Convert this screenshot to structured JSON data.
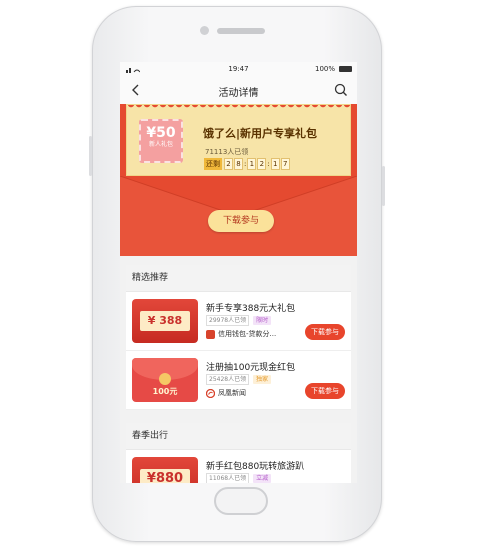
{
  "status_bar": {
    "time": "19:47",
    "battery": "100%"
  },
  "nav": {
    "title": "活动详情",
    "back_icon": "chevron-left-icon",
    "search_icon": "search-icon"
  },
  "banner": {
    "coupon_amount": "¥50",
    "coupon_label": "新人礼包",
    "title": "饿了么|新用户专享礼包",
    "claimed": "71113人已领",
    "countdown_label": "还剩",
    "countdown_digits": [
      "2",
      "8",
      "1",
      "2",
      "1",
      "7"
    ],
    "download_label": "下载参与",
    "colors": {
      "red": "#e54a30",
      "cream": "#f7e4a8"
    }
  },
  "sections": [
    {
      "heading": "精选推荐",
      "items": [
        {
          "name": "新手专享388元大礼包",
          "claimed": "29978人已领",
          "tag": "限时",
          "tag_color": "#b45cc9",
          "source": "信用钱包-贷款分...",
          "thumb_text": "¥ 388",
          "download": "下载参与"
        },
        {
          "name": "注册抽100元现金红包",
          "claimed": "25428人已领",
          "tag": "独家",
          "tag_color": "#e59a2b",
          "source": "凤凰新闻",
          "thumb_text": "100元",
          "download": "下载参与"
        }
      ]
    },
    {
      "heading": "春季出行",
      "items": [
        {
          "name": "新手红包880玩转旅游趴",
          "claimed": "11068人已领",
          "tag": "立减",
          "tag_color": "#b45cc9",
          "source": "",
          "thumb_text": "¥880",
          "download": ""
        }
      ]
    }
  ]
}
